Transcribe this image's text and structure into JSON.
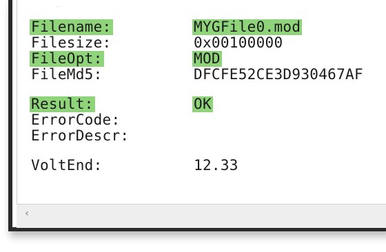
{
  "top_fragment": "_",
  "fields": [
    {
      "label": "Filename:",
      "value": "MYGFile0.mod",
      "highlight": true
    },
    {
      "label": "Filesize:",
      "value": "0x00100000",
      "highlight": false
    },
    {
      "label": "FileOpt:",
      "value": "MOD",
      "highlight": true
    },
    {
      "label": "FileMd5:",
      "value": "DFCFE52CE3D930467AF",
      "highlight": false
    },
    {
      "label": "Result:",
      "value": "OK",
      "highlight": true
    },
    {
      "label": "ErrorCode:",
      "value": "",
      "highlight": false
    },
    {
      "label": "ErrorDescr:",
      "value": "",
      "highlight": false
    },
    {
      "label": "VoltEnd:",
      "value": "12.33",
      "highlight": false
    }
  ],
  "scrollbar": {
    "left_arrow": "‹"
  },
  "colors": {
    "highlight": "#8fd37a",
    "frame": "#2a2a2a"
  }
}
